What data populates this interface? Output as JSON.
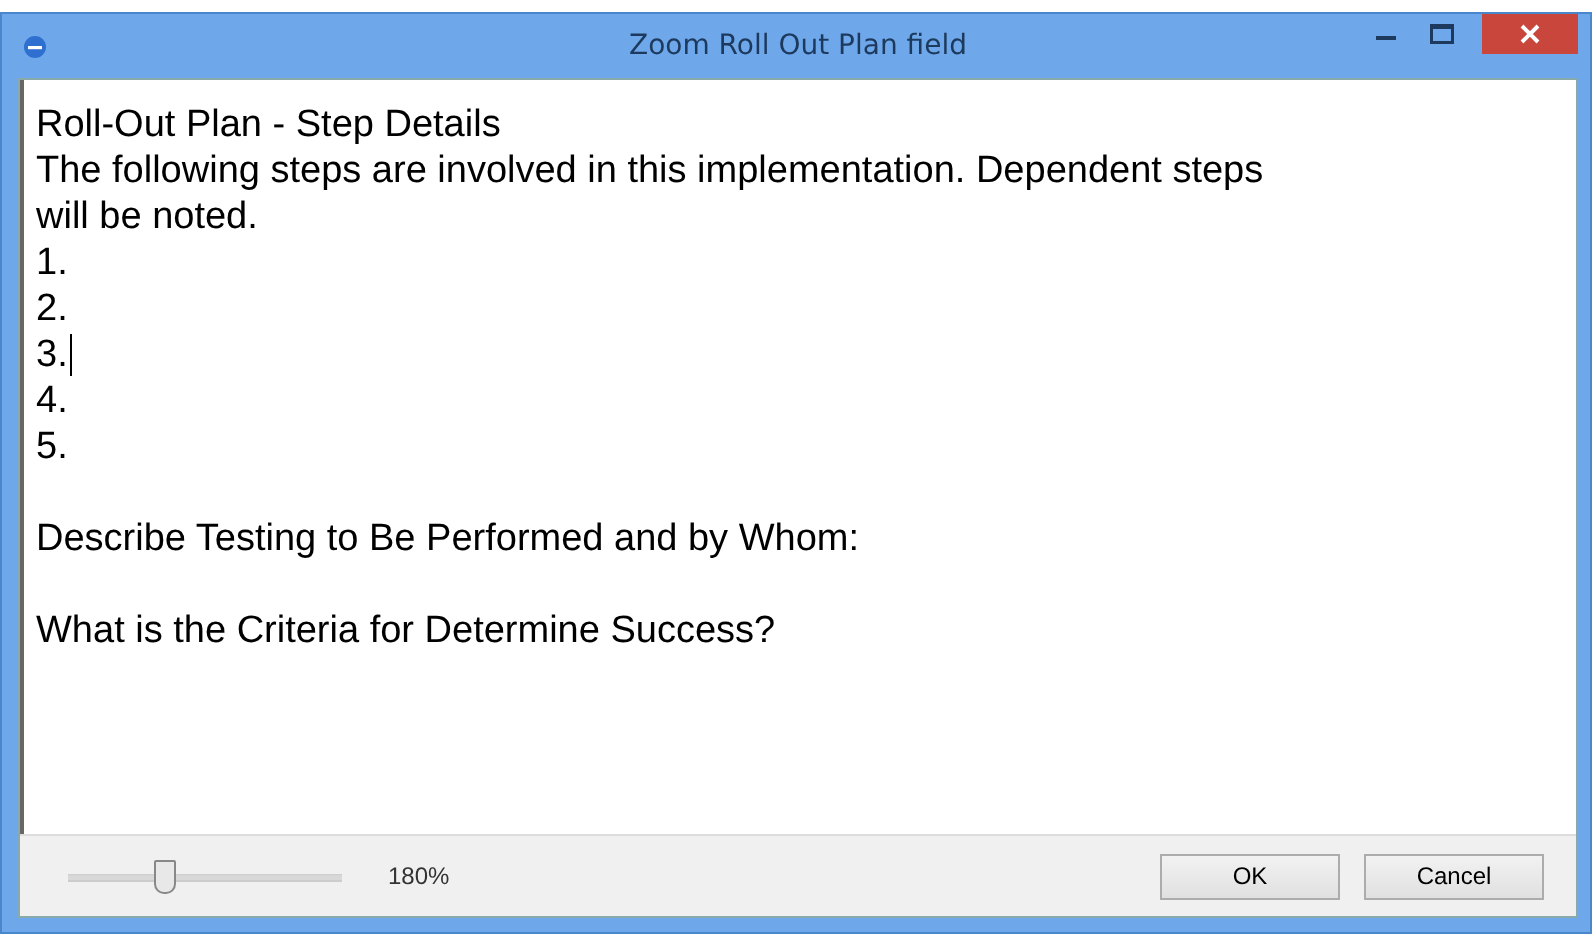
{
  "window": {
    "title": "Zoom Roll Out Plan field"
  },
  "editor": {
    "sections": [
      {
        "lines": [
          {
            "text": "Roll-Out Plan - Step Details",
            "caret": false
          },
          {
            "text": "The following steps are involved in this implementation. Dependent steps will be noted.",
            "caret": false
          },
          {
            "text": "1.",
            "caret": false
          },
          {
            "text": "2.",
            "caret": false
          },
          {
            "text": "3.",
            "caret": true
          },
          {
            "text": "4.",
            "caret": false
          },
          {
            "text": "5.",
            "caret": false
          }
        ]
      },
      {
        "lines": [
          {
            "text": "Describe Testing to Be Performed and by Whom:",
            "caret": false
          }
        ]
      },
      {
        "lines": [
          {
            "text": "What is the Criteria for Determine Success?",
            "caret": false
          }
        ]
      }
    ]
  },
  "footer": {
    "zoom": {
      "level": 0.36,
      "reading": "180%"
    },
    "buttons": [
      "OK",
      "Cancel"
    ]
  }
}
